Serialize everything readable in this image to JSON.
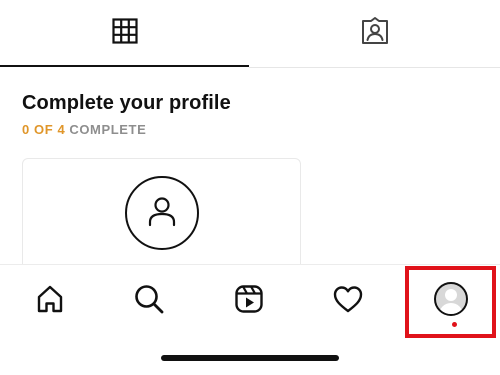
{
  "tabs": [
    {
      "name": "posts-grid",
      "icon": "grid-icon",
      "active": true
    },
    {
      "name": "tagged",
      "icon": "tagged-person-icon",
      "active": false
    }
  ],
  "profile_completion": {
    "title": "Complete your profile",
    "progress_count": "0 OF 4",
    "progress_label": "COMPLETE",
    "progress_fraction": 0,
    "accent_color": "#e0962a"
  },
  "bottom_nav": {
    "items": [
      {
        "name": "home",
        "icon": "home-icon"
      },
      {
        "name": "search",
        "icon": "search-icon"
      },
      {
        "name": "reels",
        "icon": "reels-icon"
      },
      {
        "name": "activity",
        "icon": "heart-icon"
      },
      {
        "name": "profile",
        "icon": "avatar-icon",
        "highlighted": true,
        "has_notification_dot": true
      }
    ],
    "highlight_color": "#e0121a"
  }
}
